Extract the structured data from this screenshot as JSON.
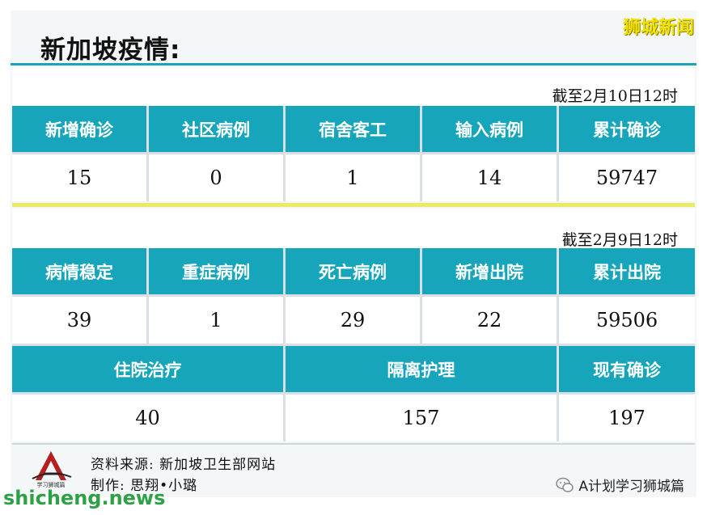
{
  "header": {
    "title": "新加坡疫情:",
    "brand": "狮城新闻"
  },
  "section1": {
    "asof": "截至2月10日12时",
    "cells": [
      {
        "label": "新增确诊",
        "value": "15"
      },
      {
        "label": "社区病例",
        "value": "0"
      },
      {
        "label": "宿舍客工",
        "value": "1"
      },
      {
        "label": "输入病例",
        "value": "14"
      },
      {
        "label": "累计确诊",
        "value": "59747"
      }
    ]
  },
  "section2": {
    "asof": "截至2月9日12时",
    "cells": [
      {
        "label": "病情稳定",
        "value": "39"
      },
      {
        "label": "重症病例",
        "value": "1"
      },
      {
        "label": "死亡病例",
        "value": "29"
      },
      {
        "label": "新增出院",
        "value": "22"
      },
      {
        "label": "累计出院",
        "value": "59506"
      }
    ],
    "cells2": [
      {
        "label": "住院治疗",
        "value": "40"
      },
      {
        "label": "隔离护理",
        "value": "157"
      },
      {
        "label": "现有确诊",
        "value": "197"
      }
    ]
  },
  "footer": {
    "source": "资料来源: 新加坡卫生部网站",
    "author": "制作: 思翔•小璐",
    "logo_text": "学习狮城篇",
    "account": "A计划学习狮城篇",
    "watermark": "shicheng.news"
  },
  "icons": {
    "logo": "logo-a-icon",
    "account": "wechat-icon"
  },
  "colors": {
    "header_cell": "#16a5bb",
    "accent_rule": "#1aa3ba",
    "divider": "#e9ec62",
    "brand": "#f2e200",
    "watermark": "#2ea046"
  }
}
